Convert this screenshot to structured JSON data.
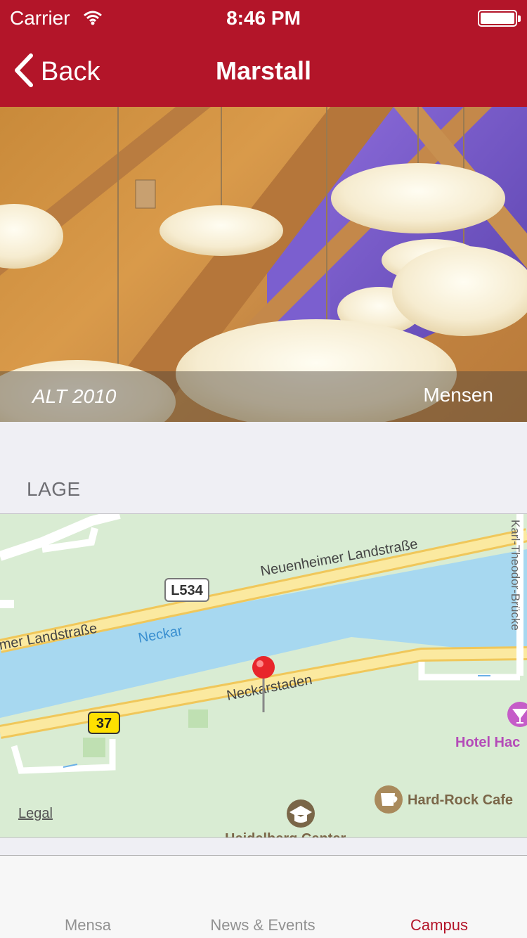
{
  "status_bar": {
    "carrier": "Carrier",
    "time": "8:46 PM"
  },
  "nav": {
    "back_label": "Back",
    "title": "Marstall"
  },
  "hero": {
    "caption_left": "ALT 2010",
    "caption_right": "Mensen"
  },
  "section": {
    "heading": "LAGE"
  },
  "map": {
    "labels": {
      "road_north": "Neuenheimer Landstraße",
      "road_north_west": "mer Landstraße",
      "road_badge_l534": "L534",
      "river": "Neckar",
      "road_south": "Neckarstaden",
      "road_badge_37": "37",
      "bridge": "Karl-Theodor-Brücke",
      "hotel": "Hotel Hac",
      "cafe": "Hard-Rock Cafe",
      "bottom_poi": "Heidelberg Center"
    },
    "legal": "Legal"
  },
  "tabs": [
    {
      "label": "Mensa",
      "active": false
    },
    {
      "label": "News & Events",
      "active": false
    },
    {
      "label": "Campus",
      "active": true
    }
  ],
  "colors": {
    "brand": "#b31529",
    "water": "#a7d8f0",
    "land": "#d9ecd3",
    "road": "#fbe9a0",
    "pin": "#e8262b"
  }
}
